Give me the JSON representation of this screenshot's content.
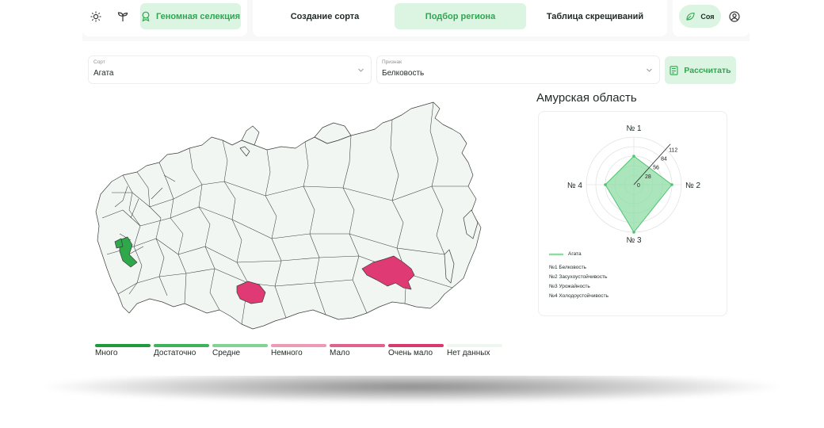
{
  "nav": {
    "genomic_label": "Геномная селекция",
    "tabs": [
      {
        "label": "Создание сорта",
        "active": false
      },
      {
        "label": "Подбор региона",
        "active": true
      },
      {
        "label": "Таблица скрещиваний",
        "active": false
      }
    ],
    "crop_label": "Соя"
  },
  "filters": {
    "variety": {
      "caption": "Сорт",
      "value": "Агата"
    },
    "trait": {
      "caption": "Признак",
      "value": "Белковость"
    },
    "calculate_label": "Рассчитать"
  },
  "region": {
    "title": "Амурская область"
  },
  "radar": {
    "axes": [
      "№ 1",
      "№ 2",
      "№ 3",
      "№ 4"
    ],
    "ticks": [
      "0",
      "28",
      "56",
      "84",
      "112"
    ],
    "series_name": "Агата",
    "values": [
      84,
      112,
      140,
      84
    ],
    "max": 140,
    "fill_color": "#8fdca4",
    "stroke_color": "#4fc470",
    "axis_legend": [
      "№1 Белковость",
      "№2 Засухоустойчивость",
      "№3 Урожайность",
      "№4 Холодоустойчивость"
    ]
  },
  "map_legend": [
    {
      "label": "Много",
      "color": "#1f9a3c"
    },
    {
      "label": "Достаточно",
      "color": "#3fb35a"
    },
    {
      "label": "Средне",
      "color": "#7fd494"
    },
    {
      "label": "Немного",
      "color": "#ef9ab5"
    },
    {
      "label": "Мало",
      "color": "#e0628e"
    },
    {
      "label": "Очень мало",
      "color": "#d83a6e"
    },
    {
      "label": "Нет данных",
      "color": "#eef7ef"
    }
  ],
  "colors": {
    "accent": "#2fa650",
    "accent_bg": "#dcf4e2",
    "map_fill": "#f1f6f2",
    "map_stroke": "#3b3f3d"
  }
}
